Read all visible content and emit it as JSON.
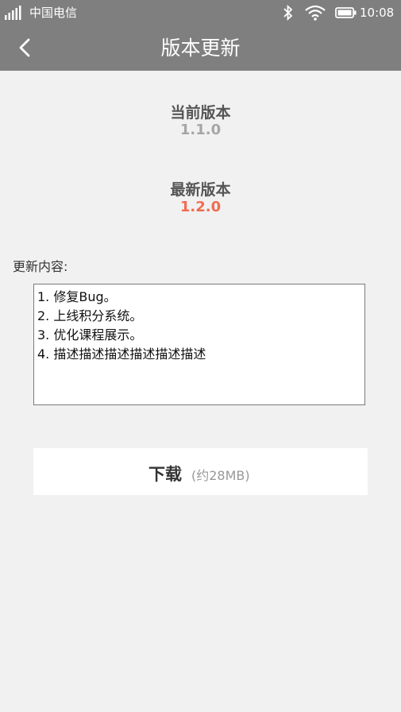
{
  "status_bar": {
    "carrier": "中国电信",
    "time": "10:08",
    "icons": [
      "signal-icon",
      "bluetooth-icon",
      "wifi-icon",
      "battery-icon"
    ]
  },
  "nav": {
    "back_icon": "chevron-left-icon",
    "title": "版本更新"
  },
  "current_version": {
    "label": "当前版本",
    "value": "1.1.0",
    "color": "#a6a6a6"
  },
  "latest_version": {
    "label": "最新版本",
    "value": "1.2.0",
    "color": "#f06c50"
  },
  "update_notes": {
    "label": "更新内容:",
    "lines": [
      "1. 修复Bug。",
      "2. 上线积分系统。",
      "3. 优化课程展示。",
      "4. 描述描述描述描述描述描述"
    ]
  },
  "download_button": {
    "label": "下载",
    "size_hint": "(约28MB)"
  },
  "colors": {
    "header_bg": "#7f7f7f",
    "page_bg": "#f1f1f1",
    "accent_new": "#f06c50"
  }
}
